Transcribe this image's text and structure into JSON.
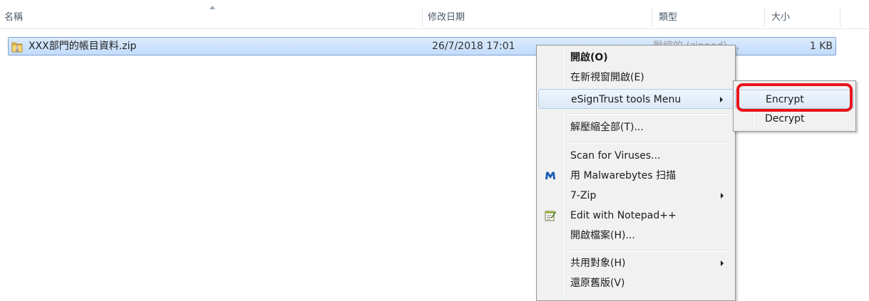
{
  "columns": {
    "name": "名稱",
    "date": "修改日期",
    "type": "類型",
    "size": "大小"
  },
  "file": {
    "name": "XXX部門的帳目資料.zip",
    "date": "26/7/2018 17:01",
    "type": "壓縮的 (zipped) ...",
    "size": "1 KB",
    "icon": "zip-folder-icon"
  },
  "context_menu": {
    "items": [
      {
        "label": "開啟(O)",
        "bold": true
      },
      {
        "label": "在新視窗開啟(E)"
      },
      {
        "label": "eSignTrust tools Menu",
        "submenu": true
      },
      {
        "label": "解壓縮全部(T)..."
      },
      {
        "label": "Scan for Viruses..."
      },
      {
        "label": "用 Malwarebytes 扫描",
        "icon": "malwarebytes-icon"
      },
      {
        "label": "7-Zip",
        "submenu": true
      },
      {
        "label": "Edit with Notepad++",
        "icon": "notepad-plus-plus-icon"
      },
      {
        "label": "開啟檔案(H)..."
      },
      {
        "label": "共用對象(H)",
        "submenu": true
      },
      {
        "label": "還原舊版(V)"
      }
    ]
  },
  "submenu": {
    "items": [
      {
        "label": "Encrypt"
      },
      {
        "label": "Decrypt"
      }
    ]
  },
  "colors": {
    "highlight": "#e8141c",
    "selection": "#c1dcfc"
  }
}
